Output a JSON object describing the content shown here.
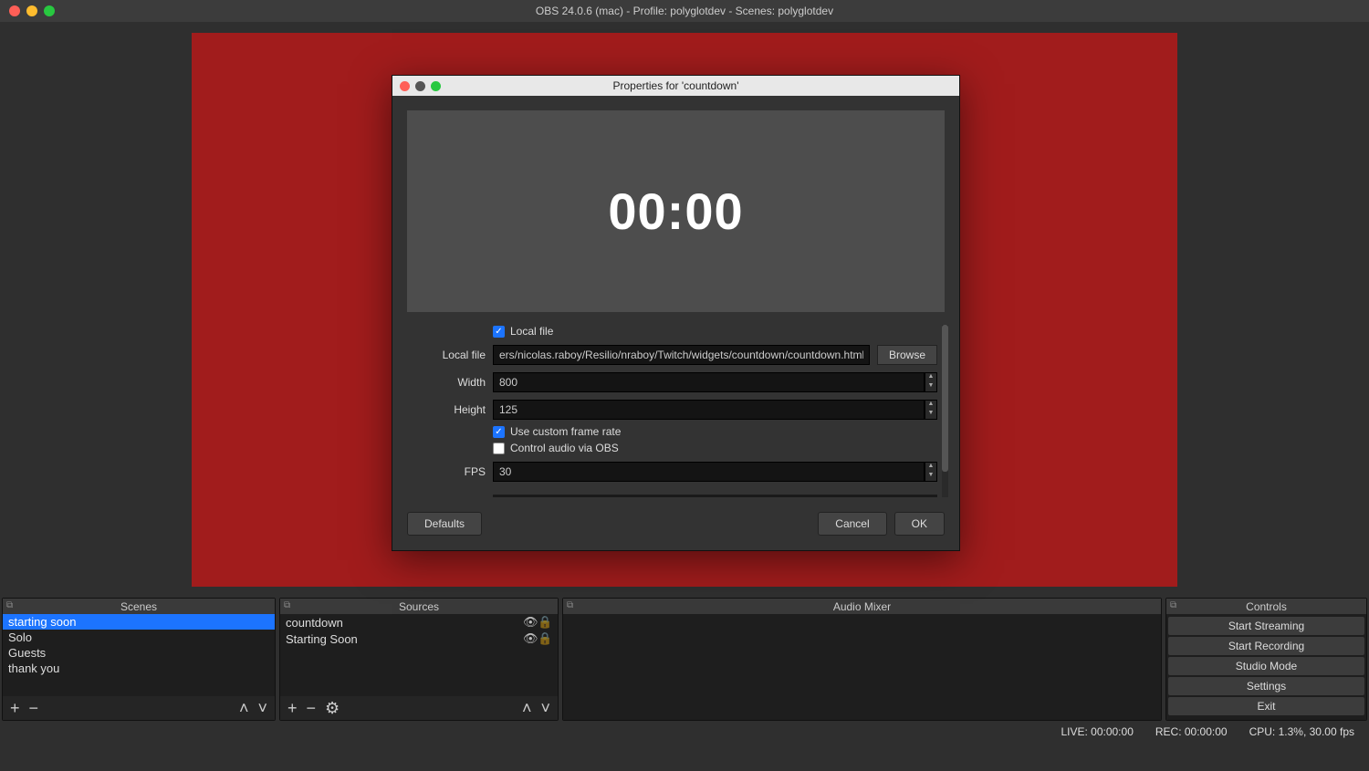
{
  "window": {
    "title": "OBS 24.0.6 (mac) - Profile: polyglotdev - Scenes: polyglotdev"
  },
  "modal": {
    "title": "Properties for 'countdown'",
    "countdown_display": "00:00",
    "local_file_checkbox_label": "Local file",
    "local_file_checkbox_checked": true,
    "local_file_label": "Local file",
    "local_file_value": "ers/nicolas.raboy/Resilio/nraboy/Twitch/widgets/countdown/countdown.html",
    "browse_label": "Browse",
    "width_label": "Width",
    "width_value": "800",
    "height_label": "Height",
    "height_value": "125",
    "custom_frame_rate_label": "Use custom frame rate",
    "custom_frame_rate_checked": true,
    "control_audio_label": "Control audio via OBS",
    "control_audio_checked": false,
    "fps_label": "FPS",
    "fps_value": "30",
    "defaults_label": "Defaults",
    "cancel_label": "Cancel",
    "ok_label": "OK"
  },
  "docks": {
    "scenes": {
      "title": "Scenes",
      "items": [
        "starting soon",
        "Solo",
        "Guests",
        "thank you"
      ],
      "selected_index": 0
    },
    "sources": {
      "title": "Sources",
      "items": [
        {
          "label": "countdown",
          "visible": true,
          "locked": true
        },
        {
          "label": "Starting Soon",
          "visible": true,
          "locked": true
        }
      ]
    },
    "mixer": {
      "title": "Audio Mixer"
    },
    "controls": {
      "title": "Controls",
      "buttons": [
        "Start Streaming",
        "Start Recording",
        "Studio Mode",
        "Settings",
        "Exit"
      ]
    }
  },
  "statusbar": {
    "live": "LIVE: 00:00:00",
    "rec": "REC: 00:00:00",
    "cpu": "CPU: 1.3%, 30.00 fps"
  },
  "icons": {
    "eye": "👁",
    "lock": "🔒",
    "plus": "+",
    "minus": "−",
    "gear": "⚙",
    "up": "˄",
    "down": "˅",
    "pop": "⧉"
  }
}
